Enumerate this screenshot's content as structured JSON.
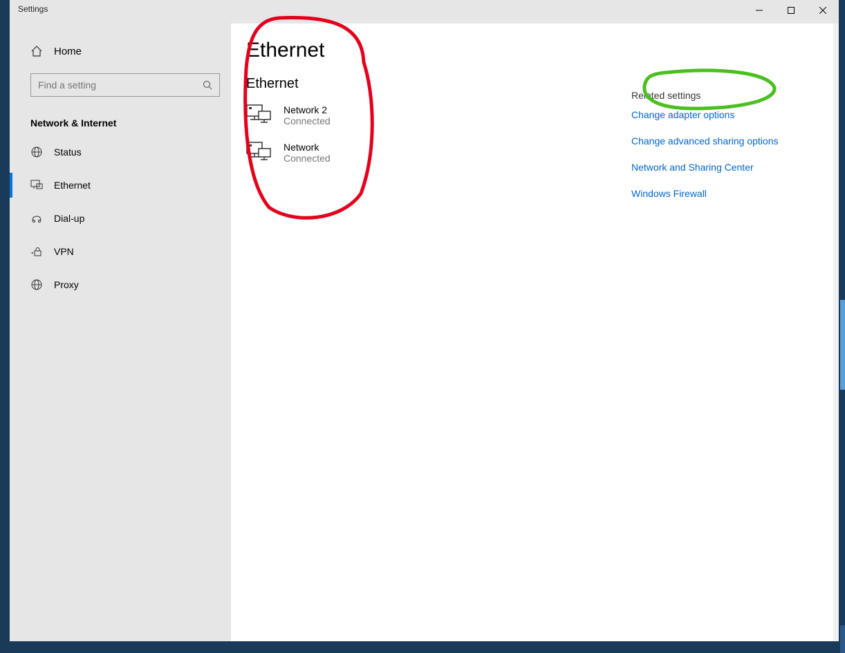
{
  "window": {
    "title": "Settings"
  },
  "sidebar": {
    "home_label": "Home",
    "search_placeholder": "Find a setting",
    "section_title": "Network & Internet",
    "items": [
      {
        "label": "Status"
      },
      {
        "label": "Ethernet"
      },
      {
        "label": "Dial-up"
      },
      {
        "label": "VPN"
      },
      {
        "label": "Proxy"
      }
    ]
  },
  "page": {
    "title": "Ethernet",
    "subtitle": "Ethernet",
    "networks": [
      {
        "name": "Network 2",
        "status": "Connected"
      },
      {
        "name": "Network",
        "status": "Connected"
      }
    ]
  },
  "related": {
    "title": "Related settings",
    "links": [
      "Change adapter options",
      "Change advanced sharing options",
      "Network and Sharing Center",
      "Windows Firewall"
    ]
  }
}
